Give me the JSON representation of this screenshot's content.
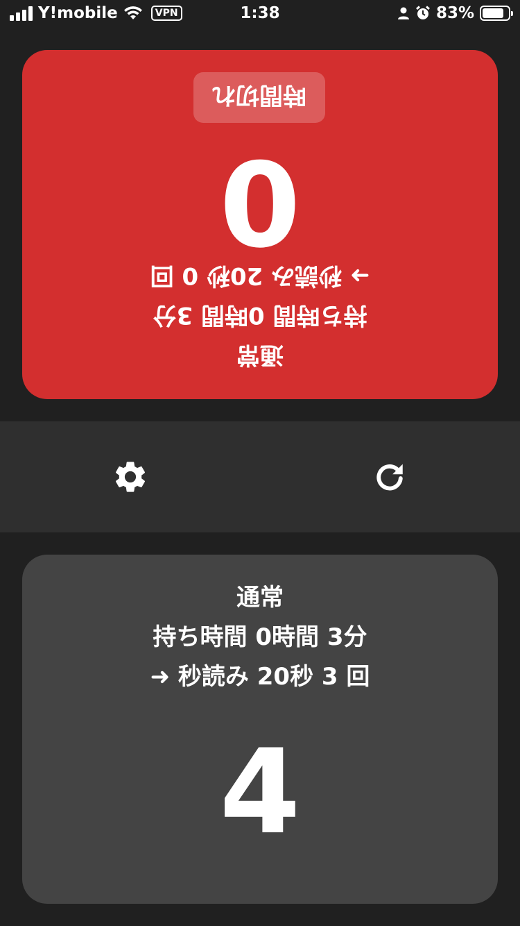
{
  "status_bar": {
    "carrier": "Y!mobile",
    "vpn": "VPN",
    "time": "1:38",
    "battery": "83%",
    "battery_level": 0.83
  },
  "players": {
    "top": {
      "status": "時間切れ",
      "count": "0",
      "mode": "通常",
      "time_setting": "持ち時間 0時間 3分",
      "byoyomi": "➜ 秒読み 20秒 0 回",
      "color": "#d32f2f"
    },
    "bottom": {
      "mode": "通常",
      "time_setting": "持ち時間 0時間 3分",
      "byoyomi": "➜ 秒読み 20秒 3 回",
      "count": "4",
      "color": "#444444"
    }
  },
  "controls": {
    "settings_icon": "gear-icon",
    "reset_icon": "refresh-icon"
  }
}
